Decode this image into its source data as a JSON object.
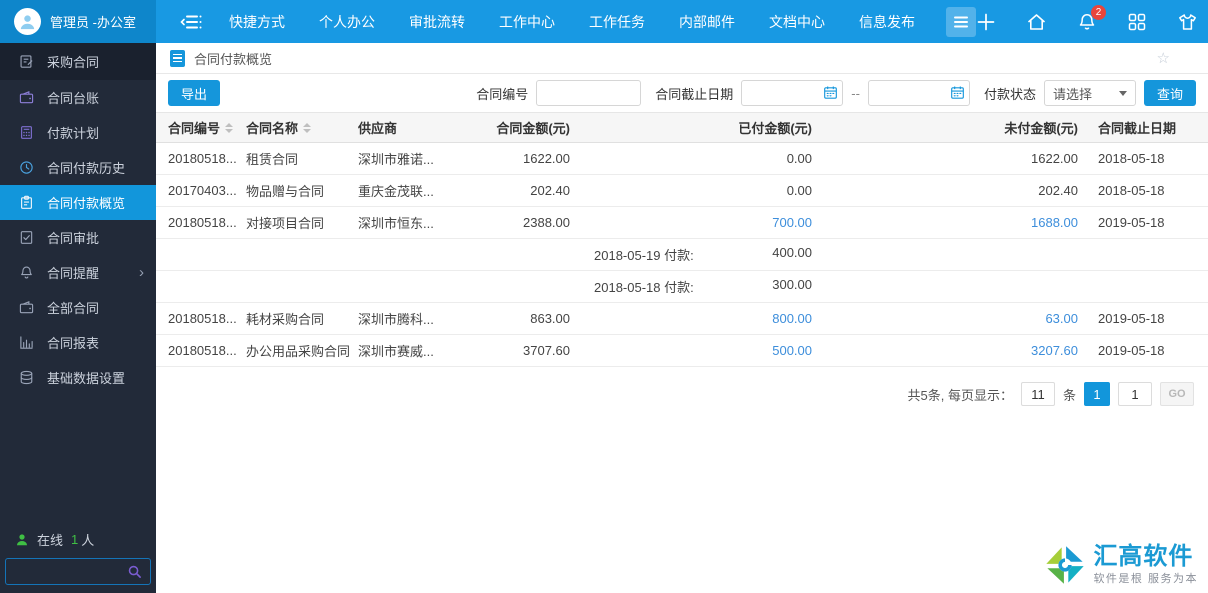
{
  "colors": {
    "accent": "#1596db",
    "topbar_bg": "#1899e3",
    "topbar_user_bg": "#0e86cb",
    "sidebar_bg": "#222a39",
    "selected_bg": "#1296db",
    "link": "#3d8edb",
    "badge": "#e8453c",
    "online": "#3fbf44",
    "logo_blue": "#1b9ad3",
    "logo_green": "#a6ce39"
  },
  "topbar": {
    "user": "管理员 -办公室",
    "nav": [
      "快捷方式",
      "个人办公",
      "审批流转",
      "工作中心",
      "工作任务",
      "内部邮件",
      "文档中心",
      "信息发布"
    ],
    "notification_count": "2"
  },
  "sidebar": {
    "items": [
      {
        "label": "采购合同"
      },
      {
        "label": "合同台账"
      },
      {
        "label": "付款计划"
      },
      {
        "label": "合同付款历史"
      },
      {
        "label": "合同付款概览"
      },
      {
        "label": "合同审批"
      },
      {
        "label": "合同提醒"
      },
      {
        "label": "全部合同"
      },
      {
        "label": "合同报表"
      },
      {
        "label": "基础数据设置"
      }
    ],
    "online_label": "在线",
    "online_count": "1",
    "online_unit": "人",
    "search_value": ""
  },
  "page": {
    "title": "合同付款概览"
  },
  "toolbar": {
    "export_label": "导出",
    "filters": {
      "contract_no_label": "合同编号",
      "contract_no_value": "",
      "end_date_label": "合同截止日期",
      "date_from_value": "",
      "date_to_value": "",
      "range_separator": "--",
      "pay_status_label": "付款状态",
      "pay_status_value": "请选择",
      "search_label": "查询"
    }
  },
  "table": {
    "headers": [
      "合同编号",
      "合同名称",
      "供应商",
      "合同金额(元)",
      "已付金额(元)",
      "未付金额(元)",
      "合同截止日期"
    ],
    "rows": [
      {
        "no": "20180518...",
        "name": "租赁合同",
        "supplier": "深圳市雅诺...",
        "amount": "1622.00",
        "paid": "0.00",
        "unpaid": "1622.00",
        "end_date": "2018-05-18"
      },
      {
        "no": "20170403...",
        "name": "物品赠与合同",
        "supplier": "重庆金茂联...",
        "amount": "202.40",
        "paid": "0.00",
        "unpaid": "202.40",
        "end_date": "2018-05-18"
      },
      {
        "no": "20180518...",
        "name": "对接项目合同",
        "supplier": "深圳市恒东...",
        "amount": "2388.00",
        "paid": "700.00",
        "unpaid": "1688.00",
        "end_date": "2019-05-18"
      },
      {
        "payment_label": "2018-05-19 付款:",
        "payment_value": "400.00"
      },
      {
        "payment_label": "2018-05-18 付款:",
        "payment_value": "300.00"
      },
      {
        "no": "20180518...",
        "name": "耗材采购合同",
        "supplier": "深圳市腾科...",
        "amount": "863.00",
        "paid": "800.00",
        "unpaid": "63.00",
        "end_date": "2019-05-18"
      },
      {
        "no": "20180518...",
        "name": "办公用品采购合同",
        "supplier": "深圳市赛威...",
        "amount": "3707.60",
        "paid": "500.00",
        "unpaid": "3207.60",
        "end_date": "2019-05-18"
      }
    ]
  },
  "pagination": {
    "total_text": "共5条, 每页显示：",
    "page_size": "11",
    "unit": "条",
    "current_page": "1",
    "goto_value": "1",
    "go_label": "GO"
  },
  "brand": {
    "name": "汇高软件",
    "tagline": "软件是根  服务为本"
  }
}
